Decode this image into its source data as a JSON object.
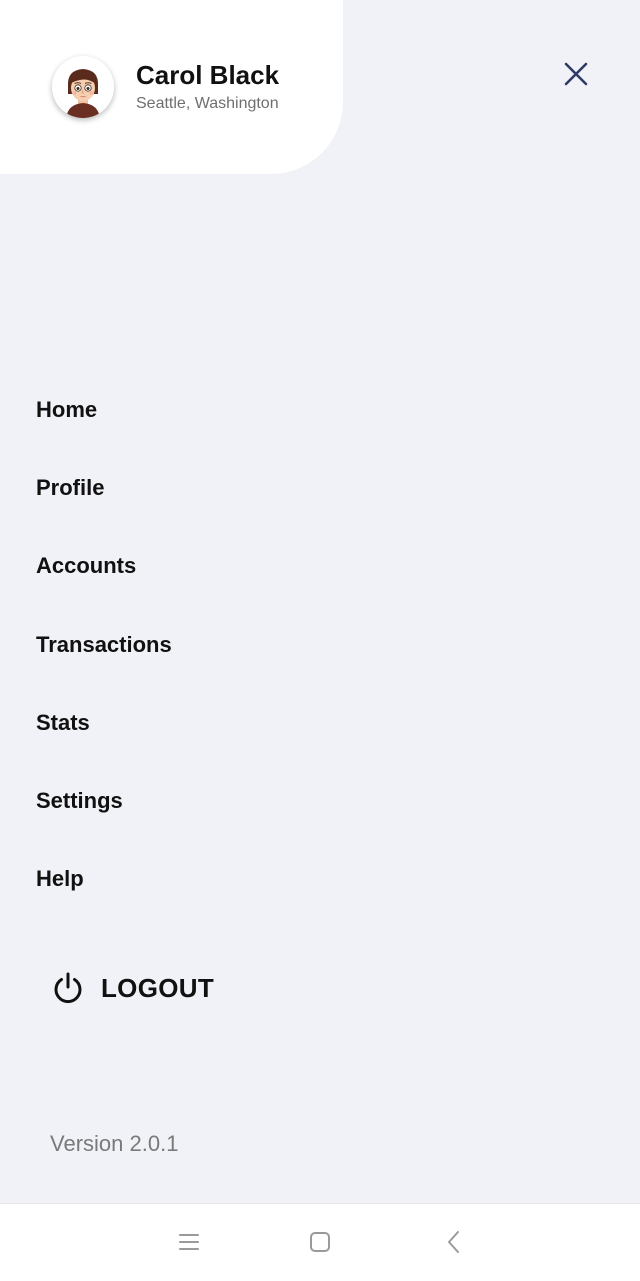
{
  "header": {
    "user_name": "Carol Black",
    "user_location": "Seattle, Washington",
    "avatar_icon": "avatar-cartoon-face",
    "close_icon": "close-icon"
  },
  "menu": {
    "items": [
      {
        "label": "Home"
      },
      {
        "label": "Profile"
      },
      {
        "label": "Accounts"
      },
      {
        "label": "Transactions"
      },
      {
        "label": "Stats"
      },
      {
        "label": "Settings"
      },
      {
        "label": "Help"
      }
    ]
  },
  "logout": {
    "label": "LOGOUT",
    "icon": "power-icon"
  },
  "footer": {
    "version": "Version 2.0.1"
  },
  "system_nav": {
    "buttons": [
      "menu-icon",
      "home-square-icon",
      "back-chevron-icon"
    ]
  },
  "colors": {
    "background": "#f1f2f7",
    "card": "#ffffff",
    "close_icon": "#2f3a66",
    "text_primary": "#111111",
    "text_secondary": "#6f6f6f"
  }
}
